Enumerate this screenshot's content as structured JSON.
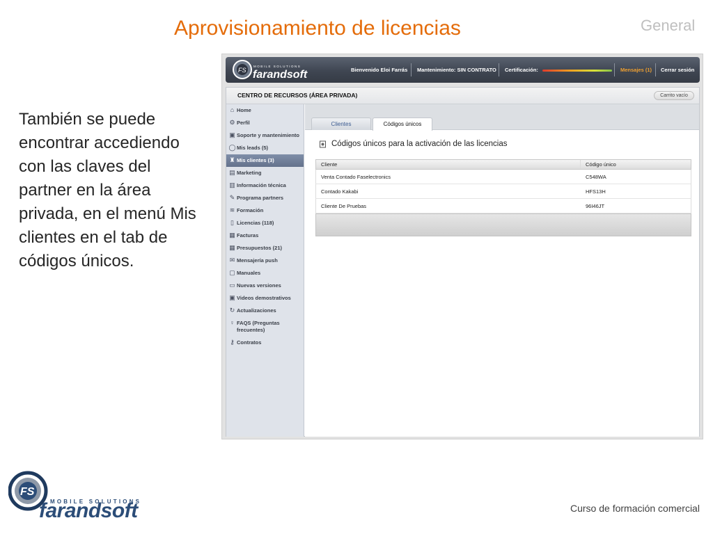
{
  "slide": {
    "title": "Aprovisionamiento de licencias",
    "section": "General",
    "body": "También se puede encontrar accediendo con las claves del partner en la área privada, en el menú Mis clientes en el tab de códigos únicos.",
    "footer": "Curso de formación comercial",
    "logo_tagline": "MOBILE SOLUTIONS",
    "logo_name": "farandsoft"
  },
  "app": {
    "topbar": {
      "welcome": "Bienvenido Eloi Farrás",
      "maintenance": "Mantenimiento:  SIN CONTRATO",
      "certification": "Certificación:",
      "messages": "Mensajes (1)",
      "logout": "Cerrar sesión"
    },
    "panel_title": "CENTRO DE RECURSOS (ÁREA PRIVADA)",
    "cart_label": "Carrito vacío",
    "sidebar": [
      {
        "label": "Home",
        "icon": "home-icon",
        "glyph": "⌂"
      },
      {
        "label": "Perfil",
        "icon": "gear-icon",
        "glyph": "⚙"
      },
      {
        "label": "Soporte y mantenimiento",
        "icon": "monitor-icon",
        "glyph": "▣"
      },
      {
        "label": "Mis leads (5)",
        "icon": "speech-bubble-icon",
        "glyph": "◯"
      },
      {
        "label": "Mis clientes (3)",
        "icon": "users-icon",
        "glyph": "♜",
        "active": true
      },
      {
        "label": "Marketing",
        "icon": "briefcase-icon",
        "glyph": "▤"
      },
      {
        "label": "Información técnica",
        "icon": "chart-icon",
        "glyph": "▥"
      },
      {
        "label": "Programa partners",
        "icon": "pencil-icon",
        "glyph": "✎"
      },
      {
        "label": "Formación",
        "icon": "graduation-cap-icon",
        "glyph": "≋"
      },
      {
        "label": "Licencias (118)",
        "icon": "phone-icon",
        "glyph": "▯"
      },
      {
        "label": "Facturas",
        "icon": "invoice-icon",
        "glyph": "▦"
      },
      {
        "label": "Presupuestos (21)",
        "icon": "calculator-icon",
        "glyph": "▦"
      },
      {
        "label": "Mensajería push",
        "icon": "envelope-icon",
        "glyph": "✉"
      },
      {
        "label": "Manuales",
        "icon": "document-icon",
        "glyph": "▢"
      },
      {
        "label": "Nuevas versiones",
        "icon": "folder-icon",
        "glyph": "▭"
      },
      {
        "label": "Videos demostrativos",
        "icon": "video-icon",
        "glyph": "▣"
      },
      {
        "label": "Actualizaciones",
        "icon": "refresh-icon",
        "glyph": "↻"
      },
      {
        "label": "FAQS (Preguntas frecuentes)",
        "icon": "lightbulb-icon",
        "glyph": "♀"
      },
      {
        "label": "Contratos",
        "icon": "key-icon",
        "glyph": "⚷"
      }
    ],
    "tabs": {
      "clientes": "Clientes",
      "codigos": "Códigos únicos"
    },
    "section_title": "Códigos únicos para la activación de las licencias",
    "table": {
      "headers": [
        "Cliente",
        "Código único"
      ],
      "rows": [
        [
          "Venta Contado Faselectronics",
          "C548WA"
        ],
        [
          "Contado Kakabi",
          "HFS13H"
        ],
        [
          "Cliente De Pruebas",
          "96I46JT"
        ]
      ]
    }
  }
}
